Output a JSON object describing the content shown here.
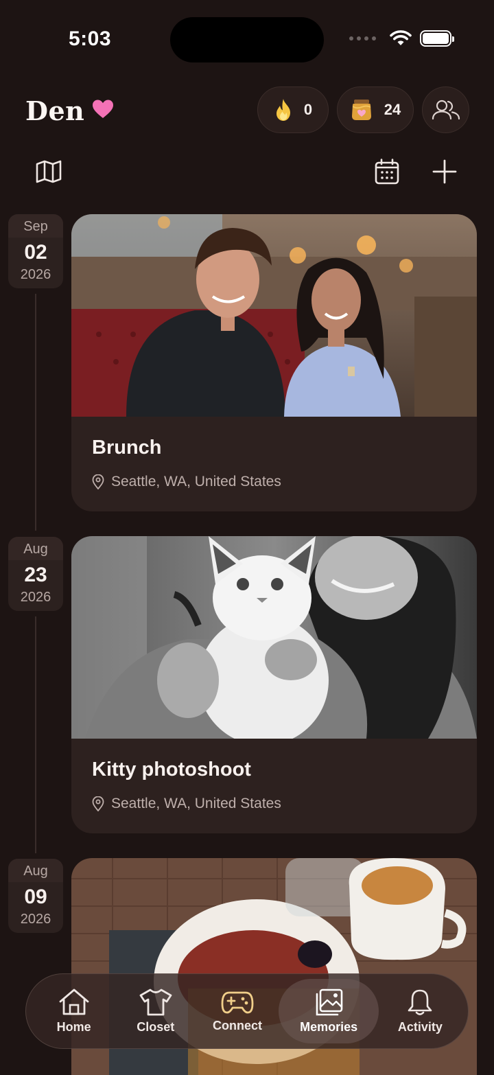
{
  "status_bar": {
    "time": "5:03"
  },
  "header": {
    "app_name": "Den",
    "flame_count": "0",
    "honey_count": "24"
  },
  "memories": [
    {
      "month": "Sep",
      "day": "02",
      "year": "2026",
      "title": "Brunch",
      "location": "Seattle, WA, United States"
    },
    {
      "month": "Aug",
      "day": "23",
      "year": "2026",
      "title": "Kitty photoshoot",
      "location": "Seattle, WA, United States"
    },
    {
      "month": "Aug",
      "day": "09",
      "year": "2026",
      "title": "",
      "location": ""
    }
  ],
  "nav": {
    "items": [
      {
        "label": "Home",
        "icon": "home-icon"
      },
      {
        "label": "Closet",
        "icon": "shirt-icon"
      },
      {
        "label": "Connect",
        "icon": "gamepad-icon"
      },
      {
        "label": "Memories",
        "icon": "photos-icon",
        "active": true
      },
      {
        "label": "Activity",
        "icon": "bell-icon"
      }
    ]
  },
  "colors": {
    "background": "#1d1413",
    "card": "#2d211f",
    "accent_heart": "#f472b6",
    "flame": "#f5c542"
  }
}
